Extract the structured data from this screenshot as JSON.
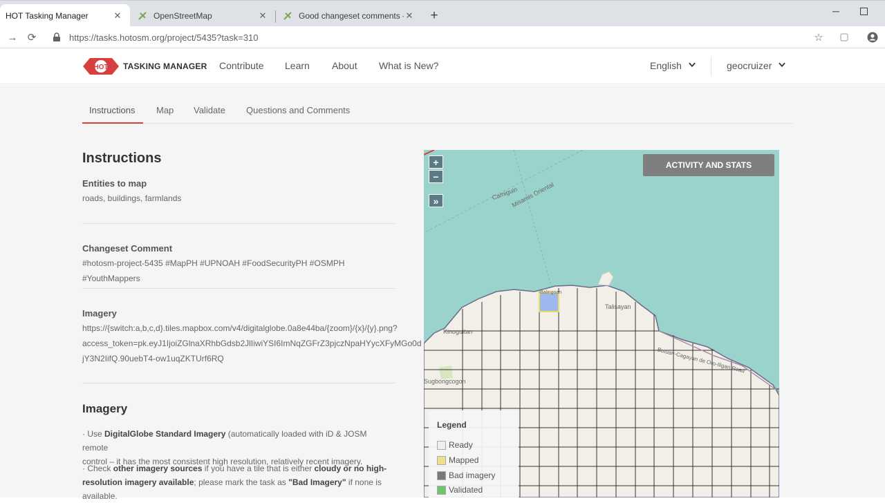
{
  "browser": {
    "tabs": [
      {
        "title": "HOT Tasking Manager",
        "active": true
      },
      {
        "title": "OpenStreetMap",
        "active": false
      },
      {
        "title": "Good changeset comments - Op",
        "active": false
      }
    ],
    "url": "https://tasks.hotosm.org/project/5435?task=310"
  },
  "header": {
    "logo_badge": "HOT",
    "logo_text": "TASKING MANAGER",
    "nav": [
      "Contribute",
      "Learn",
      "About",
      "What is New?"
    ],
    "language": "English",
    "user": "geocruizer"
  },
  "subtabs": [
    "Instructions",
    "Map",
    "Validate",
    "Questions and Comments"
  ],
  "instructions": {
    "heading": "Instructions",
    "entities_label": "Entities to map",
    "entities_value": "roads, buildings, farmlands",
    "changeset_label": "Changeset Comment",
    "changeset_value": "#hotosm-project-5435 #MapPH #UPNOAH #FoodSecurityPH #OSMPH #YouthMappers",
    "imagery_label": "Imagery",
    "imagery_line1": "https://{switch:a,b,c,d}.tiles.mapbox.com/v4/digitalglobe.0a8e44ba/{zoom}/{x}/{y}.png?",
    "imagery_line2": "access_token=pk.eyJ1IjoiZGlnaXRhbGdsb2JlIiwiYSI6ImNqZGFrZ3pjczNpaHYycXFyMGo0d",
    "imagery_line3": "jY3N2IifQ.90uebT4-ow1uqZKTUrf6RQ",
    "imagery_heading": "Imagery",
    "bullet1_pre": "· Use ",
    "bullet1_bold": "DigitalGlobe Standard Imagery",
    "bullet1_post": " (automatically loaded with iD & JOSM remote",
    "bullet1_line2": "control – it has the most consistent high resolution, relatively recent imagery.",
    "bullet2_pre": "· Check ",
    "bullet2_bold1": "other imagery sources",
    "bullet2_mid": " if you have a tile that is either ",
    "bullet2_bold2": "cloudy or no high-",
    "bullet2_bold3": "resolution imagery available",
    "bullet2_mid2": "; please mark the task as ",
    "bullet2_bold4": "\"Bad Imagery\"",
    "bullet2_post": " if none is",
    "bullet2_line3": "available."
  },
  "map": {
    "zoom_in": "+",
    "zoom_out": "−",
    "expand": "»",
    "stats_button": "ACTIVITY AND STATS",
    "labels": [
      "Camiguin",
      "Misamis Oriental",
      "Talisayan",
      "Kinoguitan",
      "Sugbongcogon",
      "Butuan-Cagayan de Oro-Iligan Road",
      "Balingoan"
    ],
    "legend_title": "Legend",
    "legend": [
      {
        "label": "Ready",
        "color": "#eeeeee"
      },
      {
        "label": "Mapped",
        "color": "#f0e08c"
      },
      {
        "label": "Bad imagery",
        "color": "#7a7a7a"
      },
      {
        "label": "Validated",
        "color": "#6fc36a"
      }
    ]
  }
}
